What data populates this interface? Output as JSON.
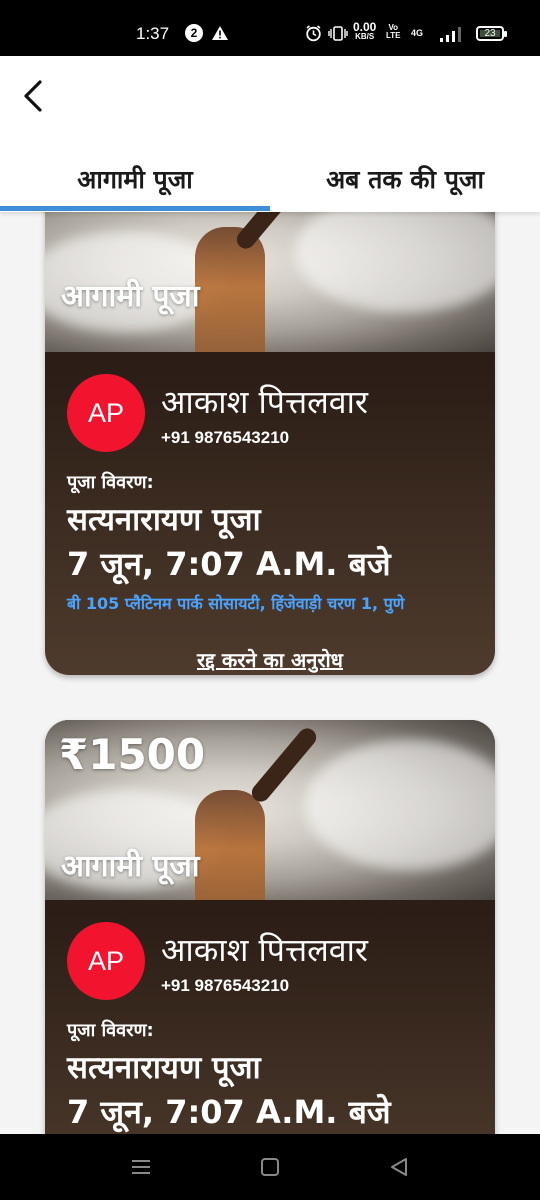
{
  "status_bar": {
    "time": "1:37",
    "notification_badge": "2",
    "alert_icon": "warning-icon",
    "net_speed_value": "0.00",
    "net_speed_unit": "KB/S",
    "volte_top": "Vo",
    "volte_bottom": "LTE",
    "network_type": "4G",
    "battery": "23"
  },
  "header": {
    "back_icon": "back-arrow-icon",
    "tabs": [
      {
        "label": "आगामी पूजा",
        "selected": true
      },
      {
        "label": "अब तक की पूजा",
        "selected": false
      }
    ],
    "indicator_color": "#3f8fd8"
  },
  "cards": [
    {
      "hero_label": "आगामी पूजा",
      "avatar_initials": "AP",
      "name": "आकाश पित्तलवार",
      "phone": "+91 9876543210",
      "detail_label": "पूजा विवरण:",
      "puja_name": "सत्यनारायण पूजा",
      "puja_time": "7 जून, 7:07 A.M. बजे",
      "address": "बी 105 प्लैटिनम पार्क सोसायटी, हिंजेवाड़ी चरण 1, पुणे",
      "cancel_label": "रद्द करने का अनुरोध"
    },
    {
      "price": "₹1500",
      "hero_label": "आगामी पूजा",
      "avatar_initials": "AP",
      "name": "आकाश पित्तलवार",
      "phone": "+91 9876543210",
      "detail_label": "पूजा विवरण:",
      "puja_name": "सत्यनारायण पूजा",
      "puja_time": "7 जून, 7:07 A.M. बजे"
    }
  ],
  "colors": {
    "avatar": "#f2142e",
    "address": "#4aa3ff",
    "card_top": "#1d100f",
    "card_bottom": "#4e3b2d"
  },
  "nav_bar": {
    "icons": [
      "menu-icon",
      "home-icon",
      "back-triangle-icon"
    ]
  }
}
